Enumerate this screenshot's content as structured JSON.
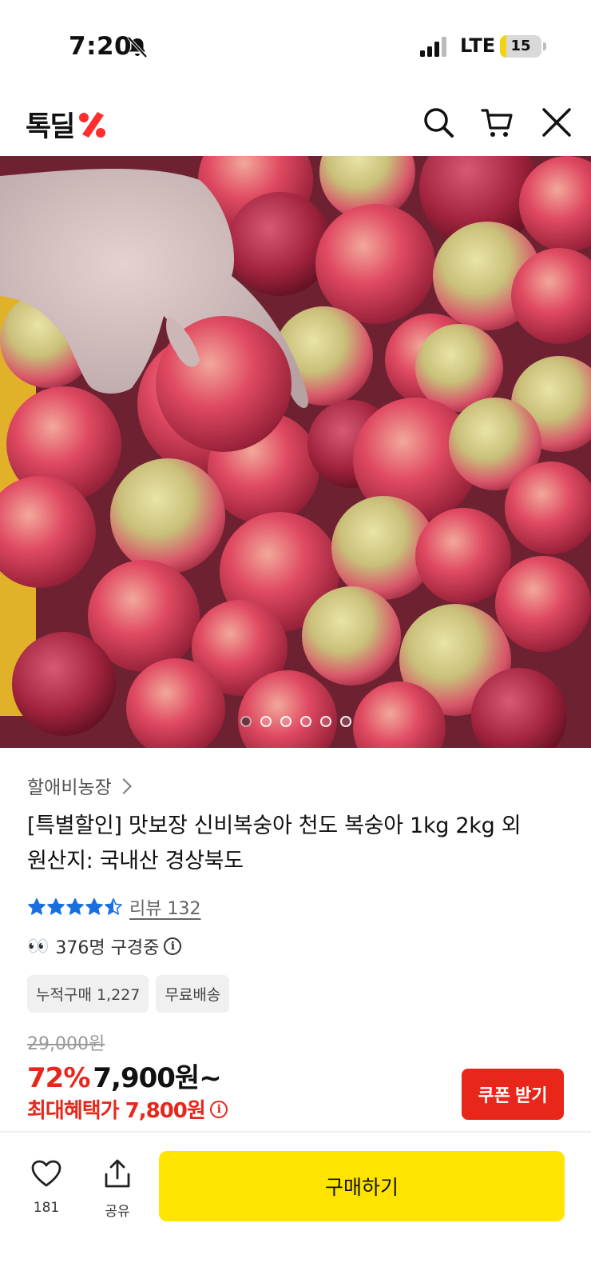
{
  "status_bar": {
    "time": "7:20",
    "network": "LTE",
    "battery": "15",
    "battery_level": 0.15
  },
  "header": {
    "logo_text": "톡딜",
    "icons": [
      "search-icon",
      "cart-icon",
      "close-icon"
    ]
  },
  "carousel": {
    "total": 6,
    "active_index": 0
  },
  "product": {
    "seller": "할애비농장",
    "title_line1": "[특별할인] 맛보장 신비복숭아 천도 복숭아 1kg 2kg 외",
    "title_line2": "원산지: 국내산 경상북도",
    "rating": 4.5,
    "review_label": "리뷰 132",
    "viewers_text": "376명 구경중",
    "eyes": "👀",
    "chips": [
      "누적구매 1,227",
      "무료배송"
    ],
    "original_price": "29,000원",
    "discount": "72%",
    "price": "7,900원~",
    "max_benefit": "최대혜택가 7,800원",
    "coupon_label": "쿠폰 받기"
  },
  "bottom_bar": {
    "like_count": "181",
    "share_label": "공유",
    "buy_label": "구매하기"
  },
  "colors": {
    "accent_red": "#e8261a",
    "buy_yellow": "#ffe400",
    "star_blue": "#1a6fe0"
  }
}
